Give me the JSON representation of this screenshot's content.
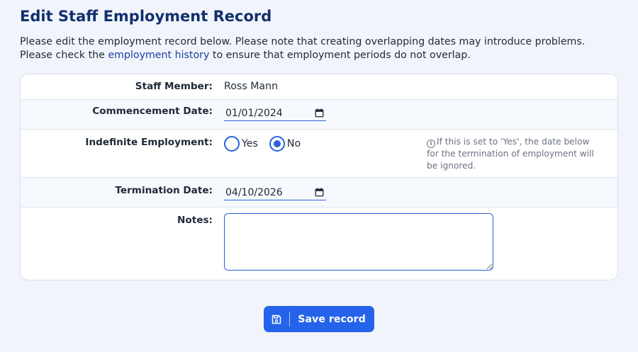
{
  "page": {
    "title": "Edit Staff Employment Record",
    "intro_before_link": "Please edit the employment record below. Please note that creating overlapping dates may introduce problems. Please check the ",
    "intro_link": "employment history",
    "intro_after_link": " to ensure that employment periods do not overlap."
  },
  "form": {
    "staff_member": {
      "label": "Staff Member:",
      "value": "Ross Mann"
    },
    "commencement_date": {
      "label": "Commencement Date:",
      "value": "01/01/2024",
      "icon": "calendar-icon"
    },
    "indefinite_employment": {
      "label": "Indefinite Employment:",
      "options": [
        {
          "label": "Yes",
          "checked": false
        },
        {
          "label": "No",
          "checked": true
        }
      ],
      "hint": "If this is set to 'Yes', the date below for the termination of employment will be ignored.",
      "hint_icon": "info-icon"
    },
    "termination_date": {
      "label": "Termination Date:",
      "value": "04/10/2026",
      "icon": "calendar-icon"
    },
    "notes": {
      "label": "Notes:",
      "value": ""
    }
  },
  "actions": {
    "save_label": "Save record",
    "save_icon": "floppy-disk-icon"
  },
  "colors": {
    "title": "#13306e",
    "link": "#1a3fa3",
    "accent": "#2563eb",
    "background": "#f1f5fb",
    "hint_text": "#6b7280"
  }
}
